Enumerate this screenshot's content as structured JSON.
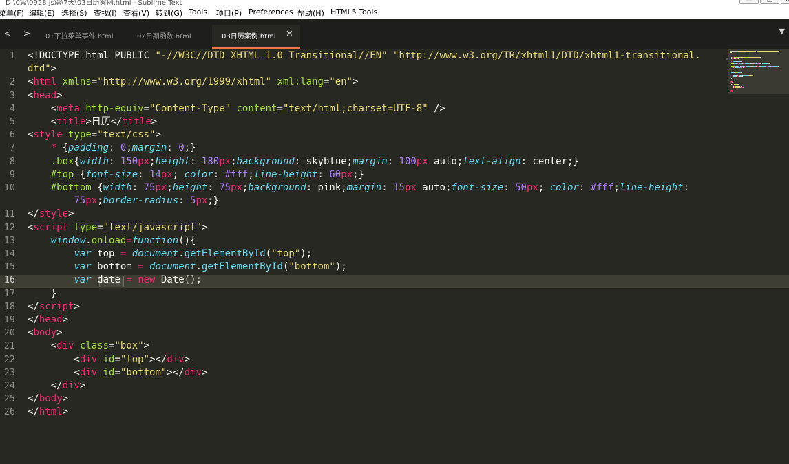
{
  "window": {
    "title": "D:\\0篇\\0928 js篇\\7天\\03日历案例.html - Sublime Text",
    "minimize": "—",
    "maximize": "□",
    "close": "✕"
  },
  "menu": [
    "菜单(F)",
    "编辑(E)",
    "选择(S)",
    "查找(I)",
    "查看(V)",
    "转到(G)",
    "Tools",
    "项目(P)",
    "Preferences",
    "帮助(H)",
    "HTML5 Tools"
  ],
  "nav": {
    "back": "<",
    "forward": ">",
    "tab_list": "▼"
  },
  "tabs": [
    {
      "label": "01下拉菜单事件.html",
      "active": false
    },
    {
      "label": "02日期函数.html",
      "active": false
    },
    {
      "label": "03日历案例.html",
      "active": true,
      "close": "✕"
    }
  ],
  "editor": {
    "current_line": 16,
    "line_numbers": [
      "1",
      "",
      "2",
      "3",
      "4",
      "5",
      "6",
      "7",
      "8",
      "9",
      "10",
      "",
      "11",
      "12",
      "13",
      "14",
      "15",
      "16",
      "17",
      "18",
      "19",
      "20",
      "21",
      "22",
      "23",
      "24",
      "25",
      "26"
    ],
    "code": [
      [
        [
          "",
          "<!DOCTYPE html PUBLIC "
        ],
        [
          "s",
          "\"-//W3C//DTD XHTML 1.0 Transitional//EN\""
        ],
        [
          "",
          " "
        ],
        [
          "s",
          "\"http://www.w3.org/TR/xhtml1/DTD/xhtml1-transitional."
        ]
      ],
      [
        [
          "s",
          "dtd\""
        ],
        [
          "",
          ">"
        ]
      ],
      [
        [
          "",
          "<"
        ],
        [
          "k",
          "html"
        ],
        [
          "",
          " "
        ],
        [
          "a",
          "xmlns"
        ],
        [
          "",
          "="
        ],
        [
          "s",
          "\"http://www.w3.org/1999/xhtml\""
        ],
        [
          "",
          " "
        ],
        [
          "a",
          "xml:lang"
        ],
        [
          "",
          "="
        ],
        [
          "s",
          "\"en\""
        ],
        [
          "",
          ">"
        ]
      ],
      [
        [
          "",
          "<"
        ],
        [
          "k",
          "head"
        ],
        [
          "",
          ">"
        ]
      ],
      [
        [
          "",
          "    <"
        ],
        [
          "k",
          "meta"
        ],
        [
          "",
          " "
        ],
        [
          "a",
          "http-equiv"
        ],
        [
          "",
          "="
        ],
        [
          "s",
          "\"Content-Type\""
        ],
        [
          "",
          " "
        ],
        [
          "a",
          "content"
        ],
        [
          "",
          "="
        ],
        [
          "s",
          "\"text/html;charset=UTF-8\""
        ],
        [
          "",
          " />"
        ]
      ],
      [
        [
          "",
          "    <"
        ],
        [
          "k",
          "title"
        ],
        [
          "",
          ">日历</"
        ],
        [
          "k",
          "title"
        ],
        [
          "",
          ">"
        ]
      ],
      [
        [
          "",
          "<"
        ],
        [
          "k",
          "style"
        ],
        [
          "",
          " "
        ],
        [
          "a",
          "type"
        ],
        [
          "",
          "="
        ],
        [
          "s",
          "\"text/css\""
        ],
        [
          "",
          ">"
        ]
      ],
      [
        [
          "",
          "    "
        ],
        [
          "k",
          "*"
        ],
        [
          "",
          " {"
        ],
        [
          "p",
          "padding"
        ],
        [
          "",
          ": "
        ],
        [
          "n",
          "0"
        ],
        [
          "",
          ";"
        ],
        [
          "p",
          "margin"
        ],
        [
          "",
          ": "
        ],
        [
          "n",
          "0"
        ],
        [
          "",
          ";}"
        ]
      ],
      [
        [
          "",
          "    "
        ],
        [
          "a",
          ".box"
        ],
        [
          "",
          "{"
        ],
        [
          "p",
          "width"
        ],
        [
          "",
          ": "
        ],
        [
          "n",
          "150"
        ],
        [
          "k",
          "px"
        ],
        [
          "",
          ";"
        ],
        [
          "p",
          "height"
        ],
        [
          "",
          ": "
        ],
        [
          "n",
          "180"
        ],
        [
          "k",
          "px"
        ],
        [
          "",
          ";"
        ],
        [
          "p",
          "background"
        ],
        [
          "",
          ": skyblue;"
        ],
        [
          "p",
          "margin"
        ],
        [
          "",
          ": "
        ],
        [
          "n",
          "100"
        ],
        [
          "k",
          "px"
        ],
        [
          "",
          " auto;"
        ],
        [
          "p",
          "text-align"
        ],
        [
          "",
          ": center;}"
        ]
      ],
      [
        [
          "",
          "    "
        ],
        [
          "a",
          "#top"
        ],
        [
          "",
          " {"
        ],
        [
          "p",
          "font-size"
        ],
        [
          "",
          ": "
        ],
        [
          "n",
          "14"
        ],
        [
          "k",
          "px"
        ],
        [
          "",
          "; "
        ],
        [
          "p",
          "color"
        ],
        [
          "",
          ": "
        ],
        [
          "n",
          "#fff"
        ],
        [
          "",
          ";"
        ],
        [
          "p",
          "line-height"
        ],
        [
          "",
          ": "
        ],
        [
          "n",
          "60"
        ],
        [
          "k",
          "px"
        ],
        [
          "",
          ";}"
        ]
      ],
      [
        [
          "",
          "    "
        ],
        [
          "a",
          "#bottom"
        ],
        [
          "",
          " {"
        ],
        [
          "p",
          "width"
        ],
        [
          "",
          ": "
        ],
        [
          "n",
          "75"
        ],
        [
          "k",
          "px"
        ],
        [
          "",
          ";"
        ],
        [
          "p",
          "height"
        ],
        [
          "",
          ": "
        ],
        [
          "n",
          "75"
        ],
        [
          "k",
          "px"
        ],
        [
          "",
          ";"
        ],
        [
          "p",
          "background"
        ],
        [
          "",
          ": pink;"
        ],
        [
          "p",
          "margin"
        ],
        [
          "",
          ": "
        ],
        [
          "n",
          "15"
        ],
        [
          "k",
          "px"
        ],
        [
          "",
          " auto;"
        ],
        [
          "p",
          "font-size"
        ],
        [
          "",
          ": "
        ],
        [
          "n",
          "50"
        ],
        [
          "k",
          "px"
        ],
        [
          "",
          "; "
        ],
        [
          "p",
          "color"
        ],
        [
          "",
          ": "
        ],
        [
          "n",
          "#fff"
        ],
        [
          "",
          ";"
        ],
        [
          "p",
          "line-height"
        ],
        [
          "",
          ":"
        ]
      ],
      [
        [
          "",
          "        "
        ],
        [
          "n",
          "75"
        ],
        [
          "k",
          "px"
        ],
        [
          "",
          ";"
        ],
        [
          "p",
          "border-radius"
        ],
        [
          "",
          ": "
        ],
        [
          "n",
          "5"
        ],
        [
          "k",
          "px"
        ],
        [
          "",
          ";}"
        ]
      ],
      [
        [
          "",
          "</"
        ],
        [
          "k",
          "style"
        ],
        [
          "",
          ">"
        ]
      ],
      [
        [
          "",
          "<"
        ],
        [
          "k",
          "script"
        ],
        [
          "",
          " "
        ],
        [
          "a",
          "type"
        ],
        [
          "",
          "="
        ],
        [
          "s",
          "\"text/javascript\""
        ],
        [
          "",
          ">"
        ]
      ],
      [
        [
          "",
          "    "
        ],
        [
          "p",
          "window"
        ],
        [
          "",
          "."
        ],
        [
          "a",
          "onload"
        ],
        [
          "k",
          "="
        ],
        [
          "p",
          "function"
        ],
        [
          "",
          "(){"
        ]
      ],
      [
        [
          "",
          "        "
        ],
        [
          "p",
          "var"
        ],
        [
          "",
          " top "
        ],
        [
          "k",
          "="
        ],
        [
          "",
          " "
        ],
        [
          "p",
          "document"
        ],
        [
          "",
          "."
        ],
        [
          "f",
          "getElementById"
        ],
        [
          "",
          "("
        ],
        [
          "s",
          "\"top\""
        ],
        [
          "",
          ");"
        ]
      ],
      [
        [
          "",
          "        "
        ],
        [
          "p",
          "var"
        ],
        [
          "",
          " bottom "
        ],
        [
          "k",
          "="
        ],
        [
          "",
          " "
        ],
        [
          "p",
          "document"
        ],
        [
          "",
          "."
        ],
        [
          "f",
          "getElementById"
        ],
        [
          "",
          "("
        ],
        [
          "s",
          "\"bottom\""
        ],
        [
          "",
          ");"
        ]
      ],
      [
        [
          "",
          "        "
        ],
        [
          "p",
          "var"
        ],
        [
          "",
          " date "
        ],
        [
          "k",
          "="
        ],
        [
          "",
          " "
        ],
        [
          "k",
          "new"
        ],
        [
          "",
          " Date();"
        ]
      ],
      [
        [
          "",
          "    }"
        ]
      ],
      [
        [
          "",
          "</"
        ],
        [
          "k",
          "script"
        ],
        [
          "",
          ">"
        ]
      ],
      [
        [
          "",
          "</"
        ],
        [
          "k",
          "head"
        ],
        [
          "",
          ">"
        ]
      ],
      [
        [
          "",
          "<"
        ],
        [
          "k",
          "body"
        ],
        [
          "",
          ">"
        ]
      ],
      [
        [
          "",
          "    <"
        ],
        [
          "k",
          "div"
        ],
        [
          "",
          " "
        ],
        [
          "a",
          "class"
        ],
        [
          "",
          "="
        ],
        [
          "s",
          "\"box\""
        ],
        [
          "",
          ">"
        ]
      ],
      [
        [
          "",
          "        <"
        ],
        [
          "k",
          "div"
        ],
        [
          "",
          " "
        ],
        [
          "a",
          "id"
        ],
        [
          "",
          "="
        ],
        [
          "s",
          "\"top\""
        ],
        [
          "",
          "></"
        ],
        [
          "k",
          "div"
        ],
        [
          "",
          ">"
        ]
      ],
      [
        [
          "",
          "        <"
        ],
        [
          "k",
          "div"
        ],
        [
          "",
          " "
        ],
        [
          "a",
          "id"
        ],
        [
          "",
          "="
        ],
        [
          "s",
          "\"bottom\""
        ],
        [
          "",
          "></"
        ],
        [
          "k",
          "div"
        ],
        [
          "",
          ">"
        ]
      ],
      [
        [
          "",
          "    </"
        ],
        [
          "k",
          "div"
        ],
        [
          "",
          ">"
        ]
      ],
      [
        [
          "",
          "</"
        ],
        [
          "k",
          "body"
        ],
        [
          "",
          ">"
        ]
      ],
      [
        [
          "",
          "</"
        ],
        [
          "k",
          "html"
        ],
        [
          "",
          ">"
        ]
      ]
    ]
  }
}
